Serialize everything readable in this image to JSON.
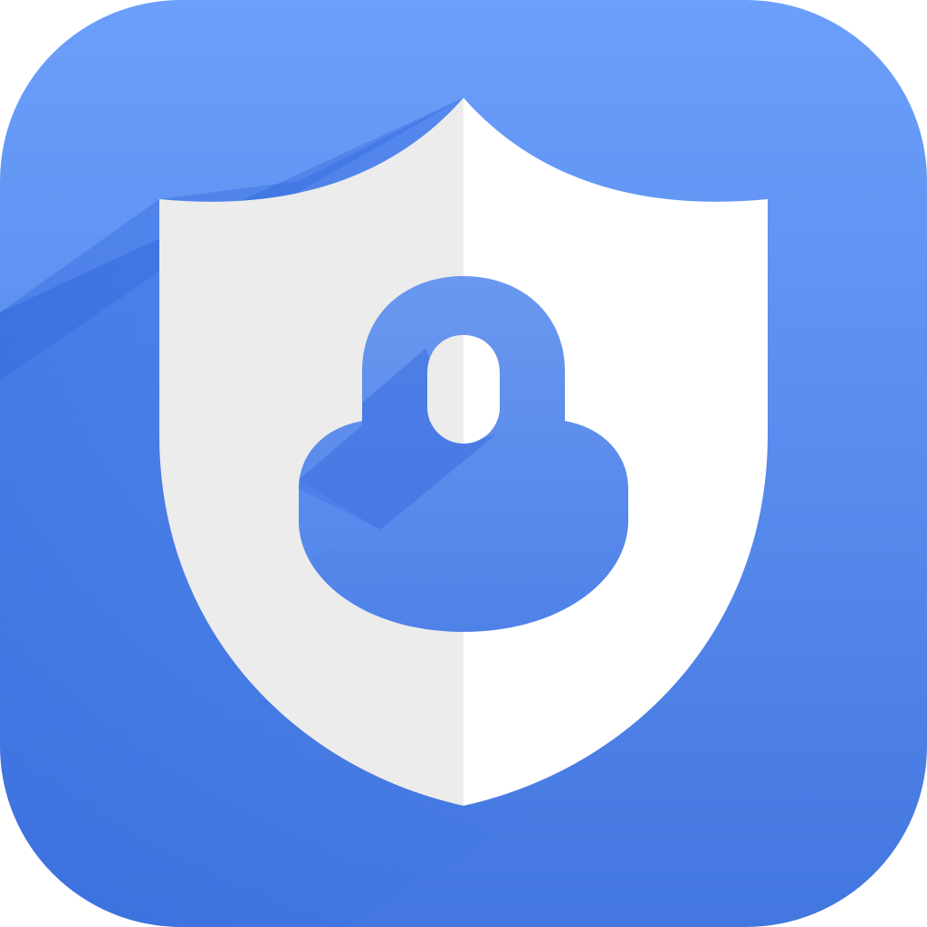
{
  "icon": {
    "name": "shield-lock-icon",
    "colors": {
      "tile_top": "#6c9ffa",
      "tile_bottom": "#4377e0",
      "long_shadow": "#2f63d9",
      "shield_left": "#ececec",
      "shield_right": "#ffffff",
      "lock_top": "#6a98ef",
      "lock_bottom": "#4f82e8",
      "lock_shadow": "#3a6ee0",
      "keyhole_left": "#ececec",
      "keyhole_right": "#ffffff"
    }
  }
}
